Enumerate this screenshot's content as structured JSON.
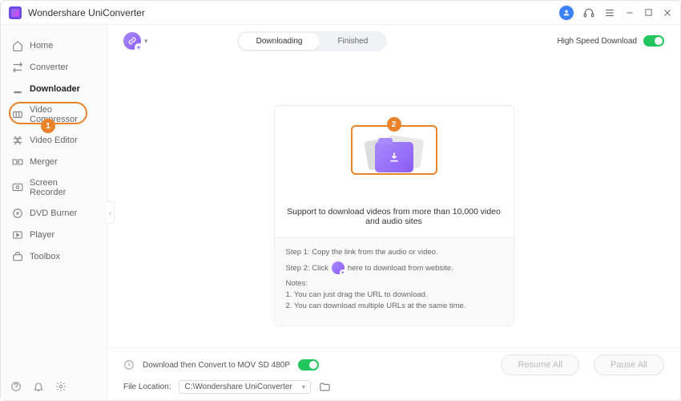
{
  "titlebar": {
    "app_name": "Wondershare UniConverter"
  },
  "sidebar": {
    "items": [
      {
        "label": "Home",
        "icon": "home"
      },
      {
        "label": "Converter",
        "icon": "converter"
      },
      {
        "label": "Downloader",
        "icon": "downloader"
      },
      {
        "label": "Video Compressor",
        "icon": "compressor"
      },
      {
        "label": "Video Editor",
        "icon": "editor"
      },
      {
        "label": "Merger",
        "icon": "merger"
      },
      {
        "label": "Screen Recorder",
        "icon": "recorder"
      },
      {
        "label": "DVD Burner",
        "icon": "dvd"
      },
      {
        "label": "Player",
        "icon": "player"
      },
      {
        "label": "Toolbox",
        "icon": "toolbox"
      }
    ]
  },
  "topbar": {
    "tabs": [
      {
        "label": "Downloading",
        "active": true
      },
      {
        "label": "Finished",
        "active": false
      }
    ],
    "high_speed_label": "High Speed Download"
  },
  "annotations": {
    "badge1": "1",
    "badge2": "2"
  },
  "panel": {
    "support_text": "Support to download videos from more than 10,000 video and audio sites",
    "step1": "Step 1: Copy the link from the audio or video.",
    "step2_a": "Step 2: Click",
    "step2_b": "here to download from website.",
    "notes_title": "Notes:",
    "note1": "1. You can just drag the URL to download.",
    "note2": "2. You can download multiple URLs at the same time."
  },
  "footer": {
    "convert_label": "Download then Convert to MOV SD 480P",
    "file_location_label": "File Location:",
    "file_location_value": "C:\\Wondershare UniConverter",
    "resume_label": "Resume All",
    "pause_label": "Pause All"
  }
}
